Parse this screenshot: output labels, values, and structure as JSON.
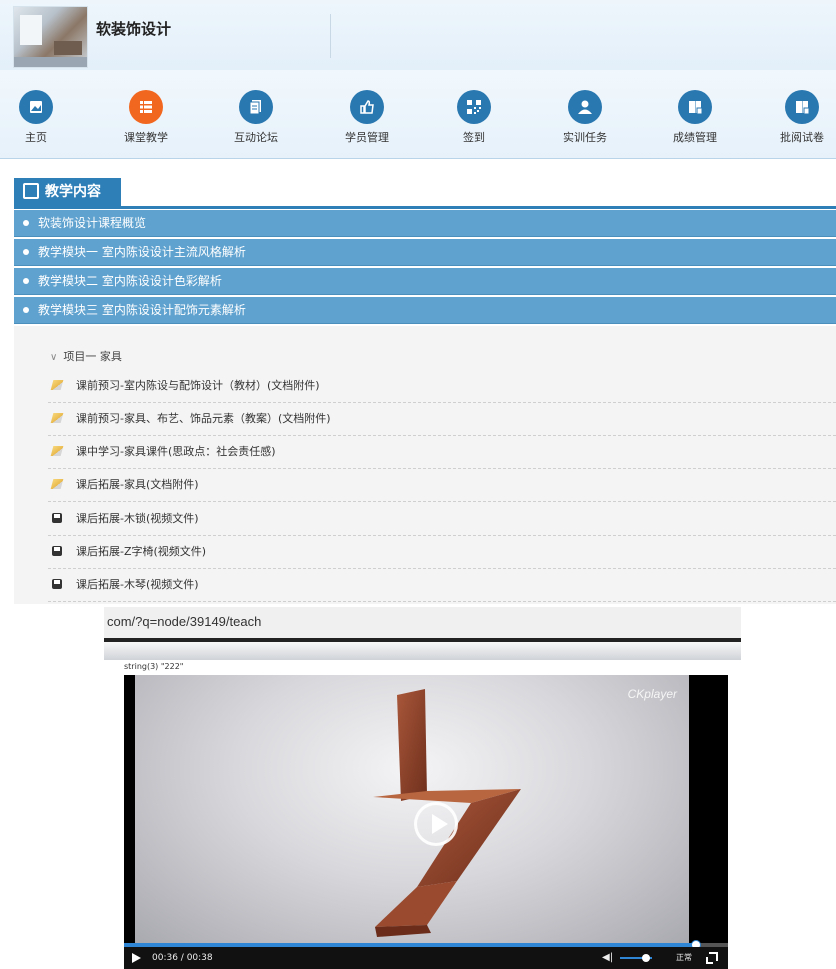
{
  "header": {
    "course_title": "软装饰设计"
  },
  "nav": [
    {
      "label": "主页",
      "icon": "image-icon",
      "active": false
    },
    {
      "label": "课堂教学",
      "icon": "list-icon",
      "active": true
    },
    {
      "label": "互动论坛",
      "icon": "document-icon",
      "active": false
    },
    {
      "label": "学员管理",
      "icon": "thumbs-up-icon",
      "active": false
    },
    {
      "label": "签到",
      "icon": "qrcode-icon",
      "active": false
    },
    {
      "label": "实训任务",
      "icon": "user-icon",
      "active": false
    },
    {
      "label": "成绩管理",
      "icon": "book-icon",
      "active": false
    },
    {
      "label": "批阅试卷",
      "icon": "book-icon",
      "active": false
    }
  ],
  "section": {
    "title": "教学内容",
    "icon": "edit-icon"
  },
  "modules": [
    "软装饰设计课程概览",
    "教学模块一 室内陈设设计主流风格解析",
    "教学模块二 室内陈设设计色彩解析",
    "教学模块三 室内陈设设计配饰元素解析"
  ],
  "project": {
    "title": "项目一 家具",
    "icon": "chevron-down-icon"
  },
  "resources": [
    {
      "label": "课前预习-室内陈设与配饰设计（教材）(文档附件)",
      "icon": "pencil-icon"
    },
    {
      "label": "课前预习-家具、布艺、饰品元素（教案）(文档附件)",
      "icon": "pencil-icon"
    },
    {
      "label": "课中学习-家具课件(思政点：社会责任感)",
      "icon": "pencil-icon"
    },
    {
      "label": "课后拓展-家具(文档附件)",
      "icon": "pencil-icon"
    },
    {
      "label": "课后拓展-木锁(视频文件)",
      "icon": "video-file-icon"
    },
    {
      "label": "课后拓展-Z字椅(视频文件)",
      "icon": "video-file-icon"
    },
    {
      "label": "课后拓展-木琴(视频文件)",
      "icon": "video-file-icon"
    }
  ],
  "browser": {
    "url": "com/?q=node/39149/teach"
  },
  "debug_text": "string(3) \"222\"",
  "player": {
    "brand": "CKplayer",
    "time": "00:36 / 00:38",
    "progress": 0.947,
    "volume": 0.8,
    "speed_label": "正常"
  }
}
